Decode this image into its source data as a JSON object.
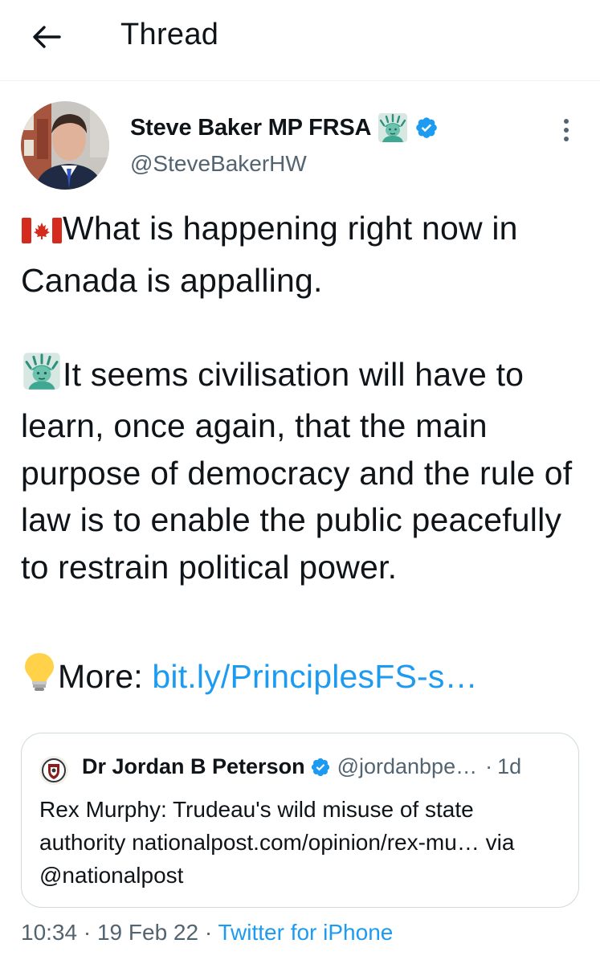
{
  "header": {
    "title": "Thread"
  },
  "tweet": {
    "author_name": "Steve Baker MP FRSA",
    "author_handle": "@SteveBakerHW",
    "line1": "What is happening right now in Canada is appalling.",
    "line2": "It seems civilisation will have to learn, once again, that the main purpose of democracy and the rule of law is to enable the public peacefully to restrain political power.",
    "more_label": "More: ",
    "more_link": "bit.ly/PrinciplesFS-s…",
    "icons": {
      "flag": "canada-flag-icon",
      "statue": "statue-of-liberty-icon",
      "bulb": "light-bulb-icon",
      "verified": "verified-badge-icon"
    }
  },
  "quote": {
    "author_name": "Dr Jordan B Peterson",
    "author_handle": "@jordanbpe…",
    "dot": "·",
    "time": "1d",
    "text": "Rex Murphy: Trudeau's wild misuse of state authority nationalpost.com/opinion/rex-mu… via @nationalpost"
  },
  "meta": {
    "time": "10:34",
    "sep1": " · ",
    "date": "19 Feb 22",
    "sep2": " · ",
    "source": "Twitter for iPhone"
  },
  "colors": {
    "accent": "#1d9bf0",
    "secondary_text": "#536471",
    "border": "#cfd9de"
  }
}
